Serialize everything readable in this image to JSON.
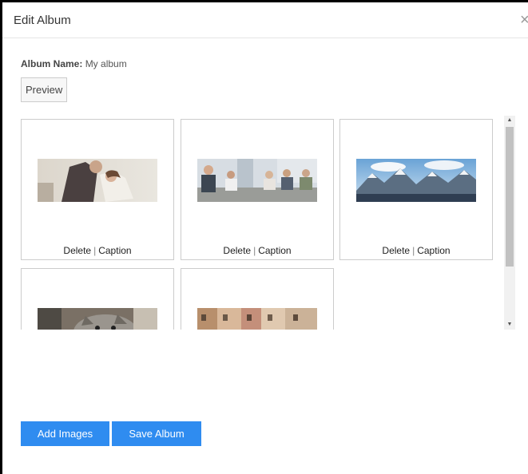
{
  "modal": {
    "title": "Edit Album",
    "close_symbol": "×"
  },
  "album": {
    "name_label": "Album Name:",
    "name_value": "My album"
  },
  "toolbar": {
    "preview_label": "Preview"
  },
  "card_actions": {
    "delete_label": "Delete",
    "separator": "|",
    "caption_label": "Caption"
  },
  "images": [
    {
      "icon": "wedding-couple-photo"
    },
    {
      "icon": "business-meeting-photo"
    },
    {
      "icon": "mountain-landscape-photo"
    },
    {
      "icon": "cat-photo"
    },
    {
      "icon": "street-buildings-photo"
    }
  ],
  "footer": {
    "add_images_label": "Add Images",
    "save_album_label": "Save Album"
  },
  "colors": {
    "accent": "#2f8cf0"
  }
}
